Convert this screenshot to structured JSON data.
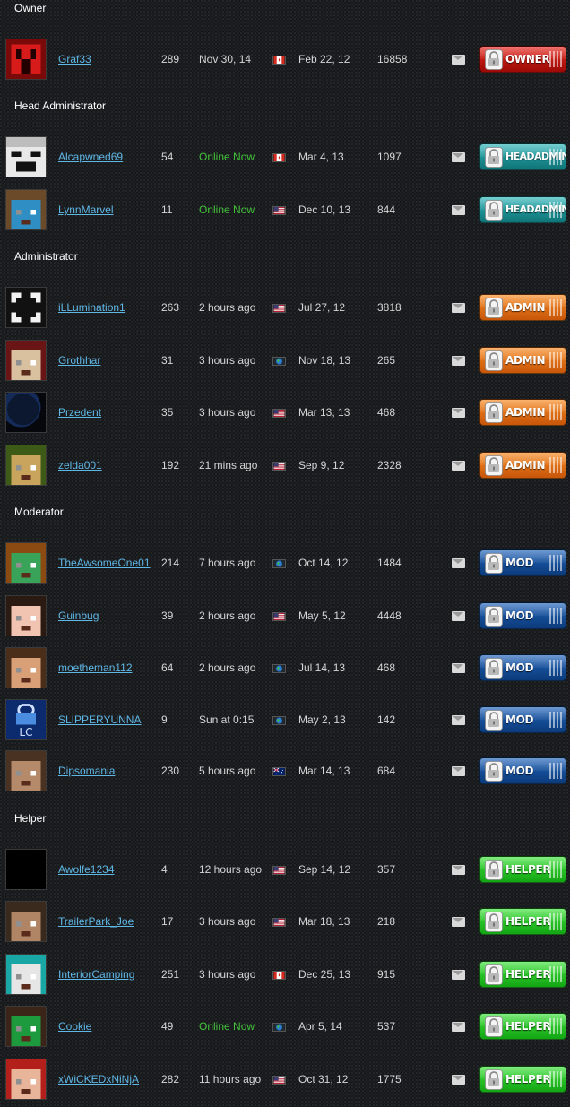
{
  "sections": [
    {
      "title": "Owner",
      "members": [
        {
          "avatar": "creeper-avatar",
          "name": "Graf33",
          "posts": "289",
          "last_seen": "Nov 30, 14",
          "online": false,
          "flag": "ca-flag",
          "joined": "Feb 22, 12",
          "reputation": "16858",
          "rank_badge": "OWNER",
          "badge_color": "#d11b14"
        }
      ]
    },
    {
      "title": "Head Administrator",
      "members": [
        {
          "avatar": "skin-avatar",
          "name": "Alcapwned69",
          "posts": "54",
          "last_seen": "Online Now",
          "online": true,
          "flag": "ca-flag",
          "joined": "Mar 4, 13",
          "reputation": "1097",
          "rank_badge": "HEADADMIN",
          "badge_color": "#1ea0a3"
        },
        {
          "avatar": "skin-avatar",
          "name": "LynnMarvel",
          "posts": "11",
          "last_seen": "Online Now",
          "online": true,
          "flag": "us-flag",
          "joined": "Dec 10, 13",
          "reputation": "844",
          "rank_badge": "HEADADMIN",
          "badge_color": "#1ea0a3"
        }
      ]
    },
    {
      "title": "Administrator",
      "members": [
        {
          "avatar": "skin-avatar",
          "name": "iLLumination1",
          "posts": "263",
          "last_seen": "2 hours ago",
          "online": false,
          "flag": "us-flag",
          "joined": "Jul 27, 12",
          "reputation": "3818",
          "rank_badge": "ADMIN",
          "badge_color": "#f07a16"
        },
        {
          "avatar": "skin-avatar",
          "name": "Grothhar",
          "posts": "31",
          "last_seen": "3 hours ago",
          "online": false,
          "flag": "globe-flag",
          "joined": "Nov 18, 13",
          "reputation": "265",
          "rank_badge": "ADMIN",
          "badge_color": "#f07a16"
        },
        {
          "avatar": "photo-avatar",
          "name": "Przedent",
          "posts": "35",
          "last_seen": "3 hours ago",
          "online": false,
          "flag": "us-flag",
          "joined": "Mar 13, 13",
          "reputation": "468",
          "rank_badge": "ADMIN",
          "badge_color": "#f07a16"
        },
        {
          "avatar": "photo-avatar",
          "name": "zelda001",
          "posts": "192",
          "last_seen": "21 mins ago",
          "online": false,
          "flag": "us-flag",
          "joined": "Sep 9, 12",
          "reputation": "2328",
          "rank_badge": "ADMIN",
          "badge_color": "#f07a16"
        }
      ]
    },
    {
      "title": "Moderator",
      "members": [
        {
          "avatar": "skin-avatar",
          "name": "TheAwsomeOne01",
          "posts": "214",
          "last_seen": "7 hours ago",
          "online": false,
          "flag": "globe-flag",
          "joined": "Oct 14, 12",
          "reputation": "1484",
          "rank_badge": "MOD",
          "badge_color": "#1553a6"
        },
        {
          "avatar": "skin-avatar",
          "name": "Guinbug",
          "posts": "39",
          "last_seen": "2 hours ago",
          "online": false,
          "flag": "us-flag",
          "joined": "May 5, 12",
          "reputation": "4448",
          "rank_badge": "MOD",
          "badge_color": "#1553a6"
        },
        {
          "avatar": "skin-avatar",
          "name": "moetheman112",
          "posts": "64",
          "last_seen": "2 hours ago",
          "online": false,
          "flag": "globe-flag",
          "joined": "Jul 14, 13",
          "reputation": "468",
          "rank_badge": "MOD",
          "badge_color": "#1553a6"
        },
        {
          "avatar": "lock-logo-avatar",
          "name": "SLIPPERYUNNA",
          "posts": "9",
          "last_seen": "Sun at 0:15",
          "online": false,
          "flag": "globe-flag",
          "joined": "May 2, 13",
          "reputation": "142",
          "rank_badge": "MOD",
          "badge_color": "#1553a6"
        },
        {
          "avatar": "skin-avatar",
          "name": "Dipsomania",
          "posts": "230",
          "last_seen": "5 hours ago",
          "online": false,
          "flag": "au-flag",
          "joined": "Mar 14, 13",
          "reputation": "684",
          "rank_badge": "MOD",
          "badge_color": "#1553a6"
        }
      ]
    },
    {
      "title": "Helper",
      "members": [
        {
          "avatar": "blank-avatar",
          "name": "Awolfe1234",
          "posts": "4",
          "last_seen": "12 hours ago",
          "online": false,
          "flag": "us-flag",
          "joined": "Sep 14, 12",
          "reputation": "357",
          "rank_badge": "HELPER",
          "badge_color": "#2bcc28"
        },
        {
          "avatar": "skin-avatar",
          "name": "TrailerPark_Joe",
          "posts": "17",
          "last_seen": "3 hours ago",
          "online": false,
          "flag": "us-flag",
          "joined": "Mar 18, 13",
          "reputation": "218",
          "rank_badge": "HELPER",
          "badge_color": "#2bcc28"
        },
        {
          "avatar": "skin-avatar",
          "name": "InteriorCamping",
          "posts": "251",
          "last_seen": "3 hours ago",
          "online": false,
          "flag": "ca-flag",
          "joined": "Dec 25, 13",
          "reputation": "915",
          "rank_badge": "HELPER",
          "badge_color": "#2bcc28"
        },
        {
          "avatar": "skin-avatar",
          "name": "Cookie",
          "posts": "49",
          "last_seen": "Online Now",
          "online": true,
          "flag": "globe-flag",
          "joined": "Apr 5, 14",
          "reputation": "537",
          "rank_badge": "HELPER",
          "badge_color": "#2bcc28"
        },
        {
          "avatar": "skin-avatar",
          "name": "xWiCKEDxNiNjA",
          "posts": "282",
          "last_seen": "11 hours ago",
          "online": false,
          "flag": "us-flag",
          "joined": "Oct 31, 12",
          "reputation": "1775",
          "rank_badge": "HELPER",
          "badge_color": "#2bcc28"
        }
      ]
    }
  ]
}
